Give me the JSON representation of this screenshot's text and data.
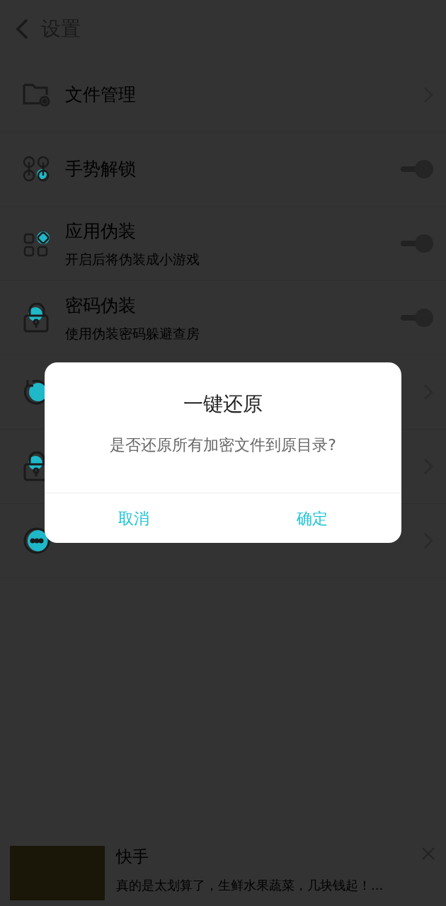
{
  "header": {
    "title": "设置"
  },
  "settings": [
    {
      "kind": "link",
      "label": "文件管理"
    },
    {
      "kind": "toggle",
      "label": "手势解锁",
      "on": true
    },
    {
      "kind": "toggle",
      "label": "应用伪装",
      "subtitle": "开启后将伪装成小游戏",
      "on": true
    },
    {
      "kind": "toggle",
      "label": "密码伪装",
      "subtitle": "使用伪装密码躲避查房",
      "on": true
    },
    {
      "kind": "link"
    },
    {
      "kind": "link"
    },
    {
      "kind": "link"
    }
  ],
  "ad": {
    "title": "快手",
    "text": "真的是太划算了，生鲜水果蔬菜，几块钱起！..."
  },
  "dialog": {
    "title": "一键还原",
    "message": "是否还原所有加密文件到原目录?",
    "buttons": [
      "取消",
      "确定"
    ]
  }
}
